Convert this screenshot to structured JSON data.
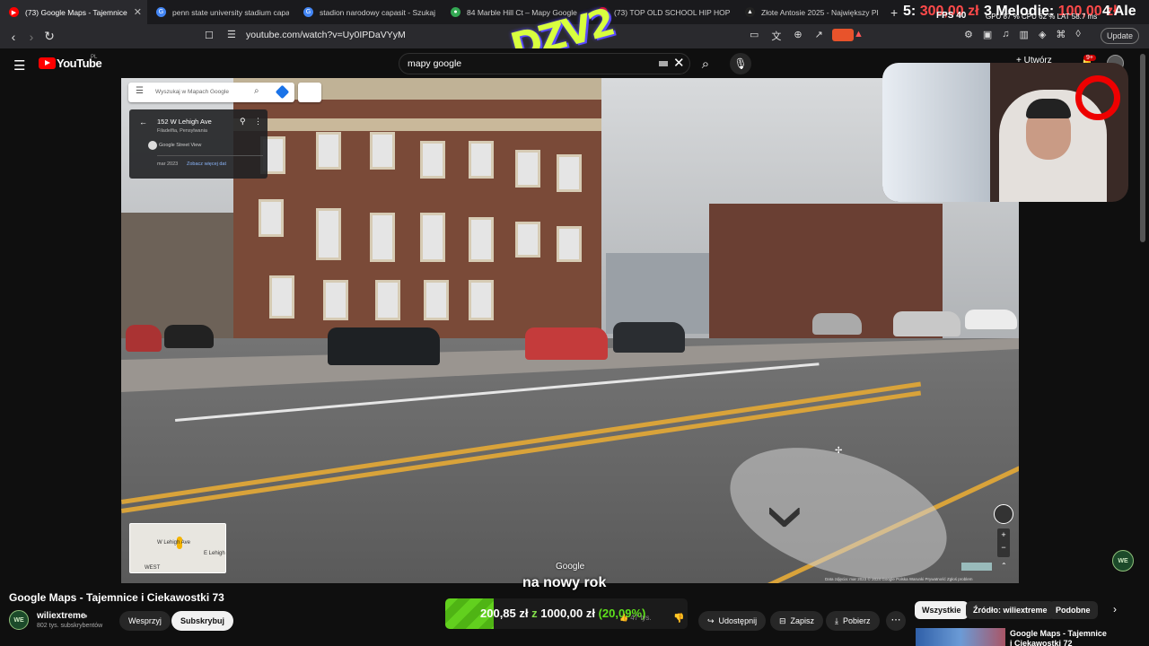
{
  "browser": {
    "tabs": [
      {
        "title": "(73) Google Maps - Tajemnice i...",
        "active": true,
        "favicon_color": "#ff0000"
      },
      {
        "title": "penn state university stadium capacit...",
        "active": false,
        "favicon_color": "#4285f4"
      },
      {
        "title": "stadion narodowy capasit - Szukaj w ...",
        "active": false,
        "favicon_color": "#4285f4"
      },
      {
        "title": "84 Marble Hill Ct – Mapy Google",
        "active": false,
        "favicon_color": "#34a853"
      },
      {
        "title": "(73) TOP OLD SCHOOL HIP HOP ...",
        "active": false,
        "favicon_color": "#ff0000"
      },
      {
        "title": "Złote Antosie 2025 - Największy Pleb...",
        "active": false,
        "favicon_color": "#ffffff"
      }
    ],
    "new_tab": "+",
    "url": "youtube.com/watch?v=Uy0IPDaVYyM",
    "update_label": "Update"
  },
  "overlay": {
    "money_prefix": "5:",
    "money_red": "300,00 zł",
    "fps_label": "FPS 40",
    "song": "3 Melodie:",
    "song_red": "100,00 zł",
    "stats": "GPU 87 %  CPU 62 %  LAT 58.7 ms",
    "alert": "4 Ale",
    "logo": "DZV2"
  },
  "youtube": {
    "logo_text": "YouTube",
    "logo_region": "PL",
    "search_value": "mapy google",
    "create_label": "+ Utwórz",
    "notif_count": "9+"
  },
  "maps": {
    "search_placeholder": "Wyszukaj w Mapach Google",
    "address": "152 W Lehigh Ave",
    "city": "Filadelfia, Pensylwania",
    "source": "Google Street View",
    "date": "mar 2023",
    "see_more": "Zobacz więcej dat",
    "minimap_street1": "W Lehigh Ave",
    "minimap_street2": "E Lehigh",
    "minimap_street3": "WEST",
    "watermark": "Google",
    "footer": "Data zdjęcia: mar 2023   © 2024 Google   Polska   Warunki   Prywatność   Zgłoś problem"
  },
  "stream": {
    "subtitle": "na nowy rok",
    "goal_current": "200,85 zł",
    "goal_sep": "z",
    "goal_target": "1000,00 zł",
    "goal_pct": "(20,09%)",
    "goal_fraction": 0.2009
  },
  "video": {
    "title": "Google Maps - Tajemnice i Ciekawostki 73",
    "channel": "wiliextreme",
    "channel_initials": "WE",
    "subscribers": "802 tys. subskrybentów",
    "support_label": "Wesprzyj",
    "subscribe_label": "Subskrybuj",
    "likes": "47 tys.",
    "share_label": "Udostępnij",
    "save_label": "Zapisz",
    "download_label": "Pobierz",
    "more_label": "⋯"
  },
  "sidebar": {
    "chips": [
      "Wszystkie",
      "Źródło: wiliextreme",
      "Podobne"
    ],
    "suggestion_title": "Google Maps - Tajemnice i Ciekawostki 72"
  }
}
